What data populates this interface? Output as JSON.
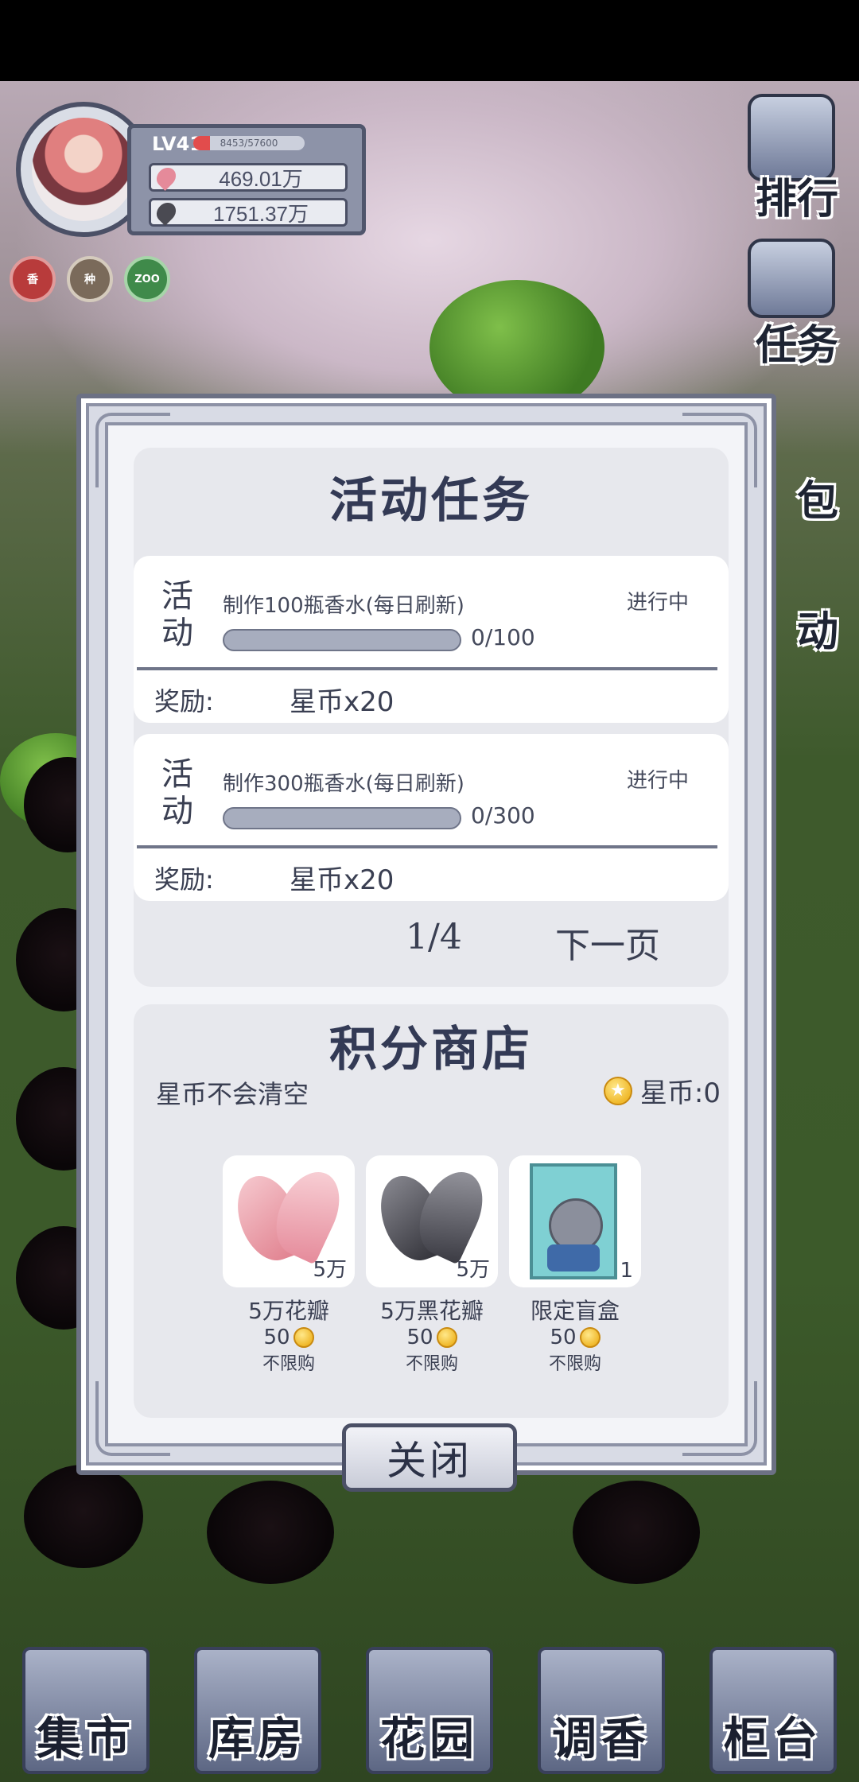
{
  "player": {
    "level": "LV41",
    "exp_text": "8453/57600",
    "exp_fraction": 0.147,
    "pink_petals": "469.01万",
    "black_petals": "1751.37万",
    "badges": [
      "香",
      "种",
      "ZOO"
    ]
  },
  "side_buttons": [
    "排行",
    "任务",
    "包",
    "动"
  ],
  "bottom_nav": [
    "集市",
    "库房",
    "花园",
    "调香",
    "柜台"
  ],
  "dialog": {
    "title": "活动任务",
    "tasks": [
      {
        "tag_line1": "活",
        "tag_line2": "动",
        "name": "制作100瓶香水(每日刷新)",
        "status": "进行中",
        "progress_text": "0/100",
        "progress_fraction": 0,
        "reward_label": "奖励:",
        "reward_value": "星币x20"
      },
      {
        "tag_line1": "活",
        "tag_line2": "动",
        "name": "制作300瓶香水(每日刷新)",
        "status": "进行中",
        "progress_text": "0/300",
        "progress_fraction": 0,
        "reward_label": "奖励:",
        "reward_value": "星币x20"
      }
    ],
    "page_indicator": "1/4",
    "next_page": "下一页",
    "shop": {
      "title": "积分商店",
      "note": "星币不会清空",
      "coin_label": "星币:0",
      "items": [
        {
          "name": "5万花瓣",
          "qty": "5万",
          "price": "50",
          "limit": "不限购",
          "icon": "pink-petal-icon"
        },
        {
          "name": "5万黑花瓣",
          "qty": "5万",
          "price": "50",
          "limit": "不限购",
          "icon": "black-petal-icon"
        },
        {
          "name": "限定盲盒",
          "qty": "1",
          "price": "50",
          "limit": "不限购",
          "icon": "blind-box-icon"
        }
      ]
    },
    "close_label": "关闭"
  },
  "colors": {
    "accent_red": "#e24c4c",
    "frame": "#6c7184",
    "text": "#3a3f52"
  }
}
